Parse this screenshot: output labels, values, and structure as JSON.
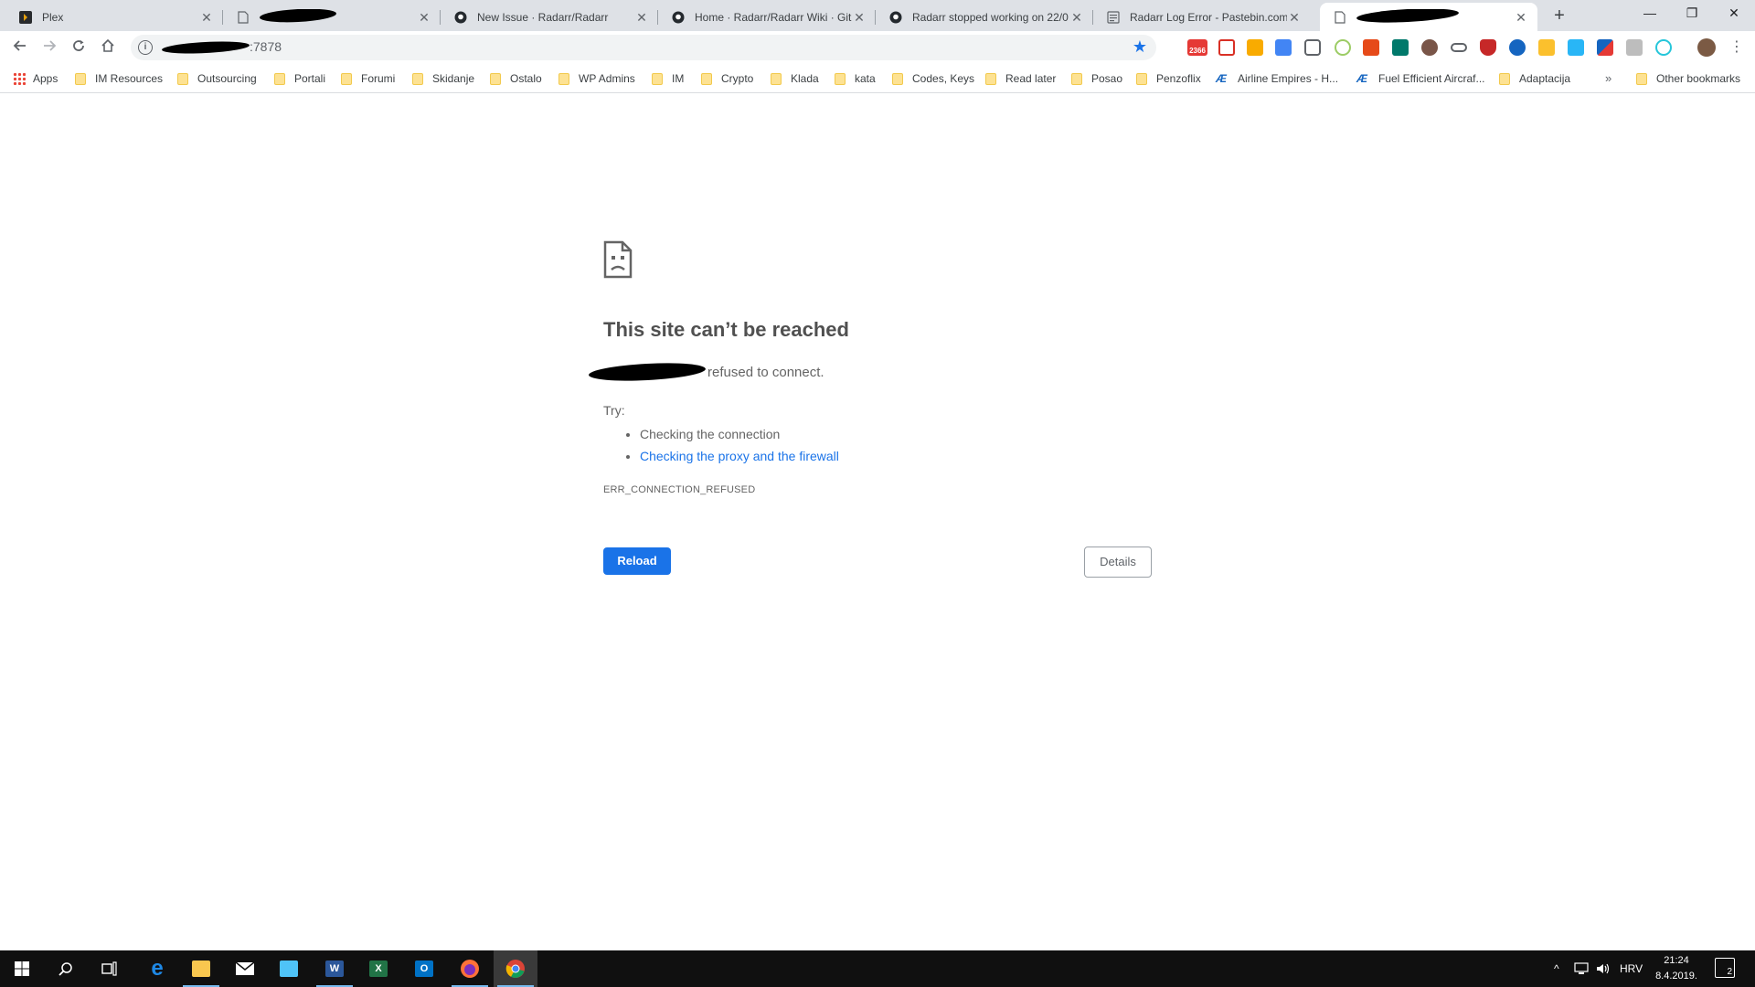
{
  "tabs": [
    {
      "title": "Plex",
      "icon": "plex-icon"
    },
    {
      "title": "",
      "icon": "page-icon",
      "redacted": true
    },
    {
      "title": "New Issue · Radarr/Radarr",
      "icon": "github-icon"
    },
    {
      "title": "Home · Radarr/Radarr Wiki · GitH",
      "icon": "github-icon"
    },
    {
      "title": "Radarr stopped working on 22/0",
      "icon": "github-icon"
    },
    {
      "title": "Radarr Log Error - Pastebin.com",
      "icon": "pastebin-icon"
    },
    {
      "title": "",
      "icon": "page-icon",
      "redacted": true,
      "active": true
    }
  ],
  "new_tab_label": "+",
  "window_controls": {
    "minimize": "—",
    "maximize": "❐",
    "close": "✕"
  },
  "omnibox": {
    "url_suffix": ":7878",
    "info_symbol": "i"
  },
  "extension_badge": "2366",
  "bookmarks": [
    {
      "label": "Apps",
      "type": "apps"
    },
    {
      "label": "IM Resources",
      "type": "folder"
    },
    {
      "label": "Outsourcing",
      "type": "folder"
    },
    {
      "label": "Portali",
      "type": "folder"
    },
    {
      "label": "Forumi",
      "type": "folder"
    },
    {
      "label": "Skidanje",
      "type": "folder"
    },
    {
      "label": "Ostalo",
      "type": "folder"
    },
    {
      "label": "WP Admins",
      "type": "folder"
    },
    {
      "label": "IM",
      "type": "folder"
    },
    {
      "label": "Crypto",
      "type": "folder"
    },
    {
      "label": "Klada",
      "type": "folder"
    },
    {
      "label": "kata",
      "type": "folder"
    },
    {
      "label": "Codes, Keys",
      "type": "folder"
    },
    {
      "label": "Read later",
      "type": "folder"
    },
    {
      "label": "Posao",
      "type": "folder"
    },
    {
      "label": "Penzoflix",
      "type": "folder"
    },
    {
      "label": "Airline Empires - H...",
      "type": "site"
    },
    {
      "label": "Fuel Efficient Aircraf...",
      "type": "site"
    },
    {
      "label": "Adaptacija",
      "type": "folder"
    }
  ],
  "bookmarks_overflow": "»",
  "other_bookmarks": "Other bookmarks",
  "error_page": {
    "title": "This site can’t be reached",
    "detail_suffix": "refused to connect.",
    "try_label": "Try:",
    "suggestions": [
      {
        "text": "Checking the connection",
        "link": false
      },
      {
        "text": "Checking the proxy and the firewall",
        "link": true
      }
    ],
    "error_code": "ERR_CONNECTION_REFUSED",
    "reload_label": "Reload",
    "details_label": "Details"
  },
  "taskbar": {
    "apps": [
      "start-icon",
      "search-icon",
      "task-view-icon",
      "edge-icon",
      "file-explorer-icon",
      "mail-icon",
      "outlook-app-icon",
      "word-icon",
      "excel-icon",
      "outlook-icon",
      "firefox-icon",
      "chrome-icon"
    ],
    "tray_expand": "^",
    "language": "HRV",
    "time": "21:24",
    "date": "8.4.2019.",
    "notification_count": "2"
  },
  "colors": {
    "accent": "#1a73e8",
    "error_text": "#646464",
    "taskbar": "#101010"
  }
}
